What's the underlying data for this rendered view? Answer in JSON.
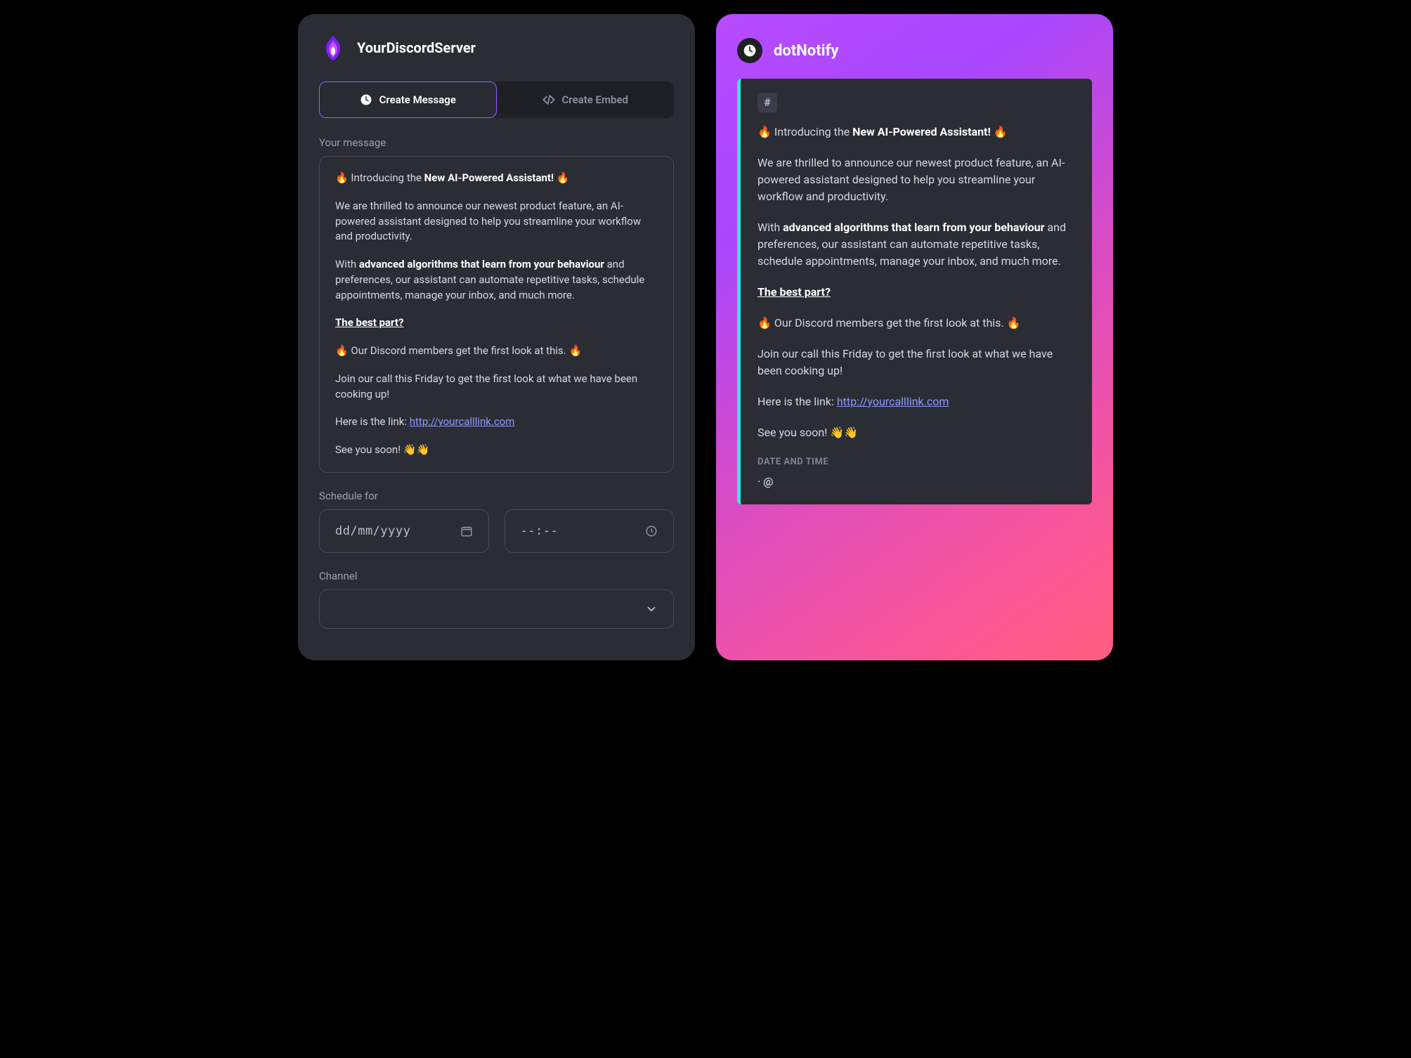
{
  "server": {
    "name": "YourDiscordServer"
  },
  "tabs": {
    "create_message": "Create Message",
    "create_embed": "Create Embed"
  },
  "labels": {
    "your_message": "Your message",
    "schedule_for": "Schedule for",
    "channel": "Channel"
  },
  "inputs": {
    "date_placeholder": "dd/mm/yyyy",
    "time_placeholder": "--:--"
  },
  "message": {
    "line1_pre": "🔥 Introducing the ",
    "line1_bold": "New AI-Powered Assistant!",
    "line1_post": " 🔥",
    "para2": "We are thrilled to announce our newest product feature, an AI-powered assistant designed to help you streamline your workflow and productivity.",
    "para3_pre": "With ",
    "para3_bold": "advanced algorithms that learn from your behaviour",
    "para3_post": " and preferences, our assistant can automate repetitive tasks, schedule appointments, manage your inbox, and much more.",
    "best_part": "The best part?",
    "para5": "🔥 Our Discord members get the first look at this. 🔥",
    "para6": "Join our call this Friday to get the first look at what we have been cooking up!",
    "link_pre": " Here is the link: ",
    "link_text": "http://yourcalllink.com",
    "see_you": " See you soon! 👋👋"
  },
  "preview": {
    "bot_name": "dotNotify",
    "hash": "#",
    "date_time_label": "DATE AND TIME",
    "date_time_value": " · @"
  }
}
